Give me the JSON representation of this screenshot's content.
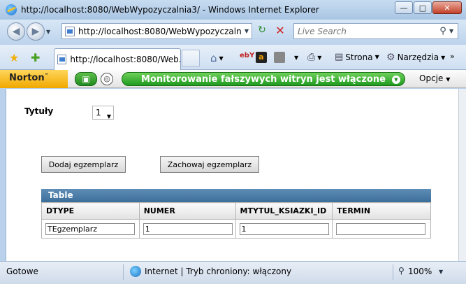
{
  "window": {
    "title": "http://localhost:8080/WebWypozyczalnia3/ - Windows Internet Explorer"
  },
  "address": {
    "url": "http://localhost:8080/WebWypozyczalnia3/",
    "search_placeholder": "Live Search"
  },
  "tab": {
    "label": "http://localhost:8080/Web..."
  },
  "commands": {
    "page": "Strona",
    "tools": "Narzędzia"
  },
  "norton": {
    "logo": "Norton",
    "trademark": "™",
    "status": "Monitorowanie fałszywych witryn jest włączone",
    "options": "Opcje"
  },
  "form": {
    "titles_label": "Tytuły",
    "titles_selected": "1",
    "add_button": "Dodaj egzemplarz",
    "save_button": "Zachowaj egzemplarz"
  },
  "table": {
    "caption": "Table",
    "columns": [
      "DTYPE",
      "NUMER",
      "MTYTUL_KSIAZKI_ID",
      "TERMIN"
    ],
    "rows": [
      [
        "TEgzemplarz",
        "1",
        "1",
        ""
      ]
    ]
  },
  "statusbar": {
    "status": "Gotowe",
    "zone": "Internet | Tryb chroniony: włączony",
    "zoom": "100%"
  },
  "colors": {
    "norton_green": "#1f9a1f",
    "norton_yellow": "#f0a800",
    "table_header": "#3c6e9a"
  }
}
